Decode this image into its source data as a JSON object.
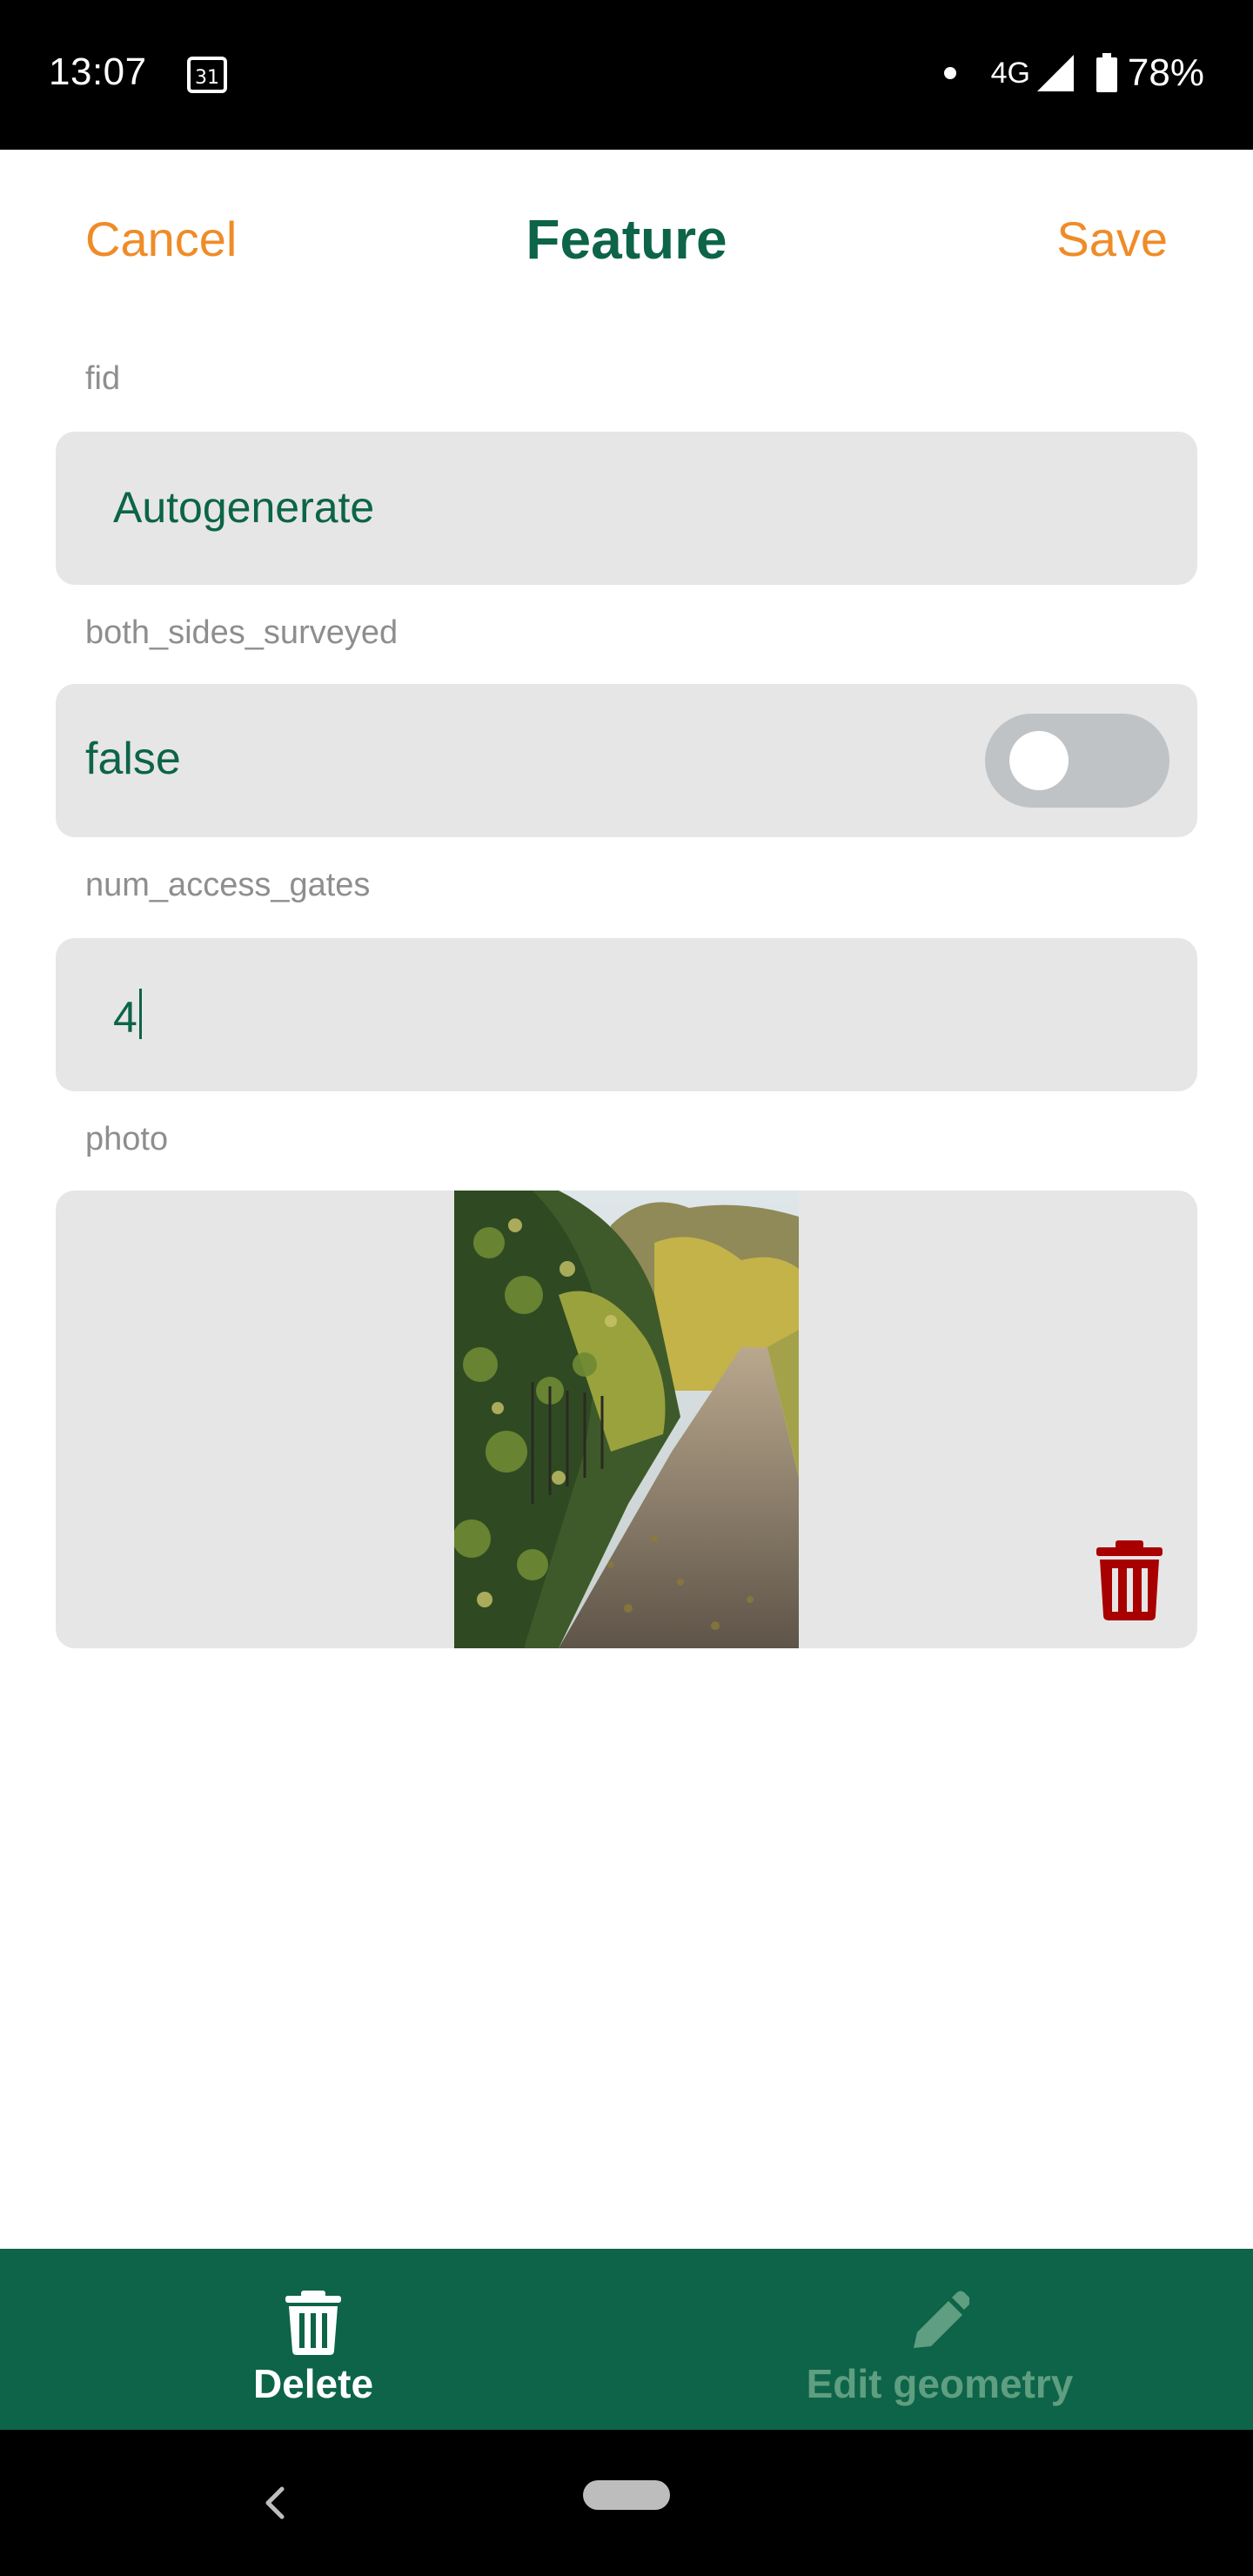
{
  "status_bar": {
    "time": "13:07",
    "calendar_day": "31",
    "network": "4G",
    "battery": "78%"
  },
  "header": {
    "cancel_label": "Cancel",
    "title": "Feature",
    "save_label": "Save"
  },
  "fields": {
    "fid": {
      "label": "fid",
      "value": "Autogenerate"
    },
    "both_sides_surveyed": {
      "label": "both_sides_surveyed",
      "value": "false",
      "checked": false
    },
    "num_access_gates": {
      "label": "num_access_gates",
      "value": "4"
    },
    "photo": {
      "label": "photo"
    }
  },
  "actions": {
    "delete_label": "Delete",
    "edit_geometry_label": "Edit geometry"
  },
  "colors": {
    "accent_orange": "#ef8c28",
    "brand_green": "#0d6448",
    "field_bg": "#e6e6e6",
    "delete_red": "#a80000",
    "disabled_green": "#5f9e80"
  },
  "icons": {
    "calendar": "calendar-icon",
    "signal": "signal-icon",
    "battery": "battery-icon",
    "photo_delete": "trash-icon",
    "delete": "trash-icon",
    "edit_geometry": "pencil-icon",
    "nav_back": "back-chevron-icon",
    "nav_home": "home-pill-icon"
  }
}
